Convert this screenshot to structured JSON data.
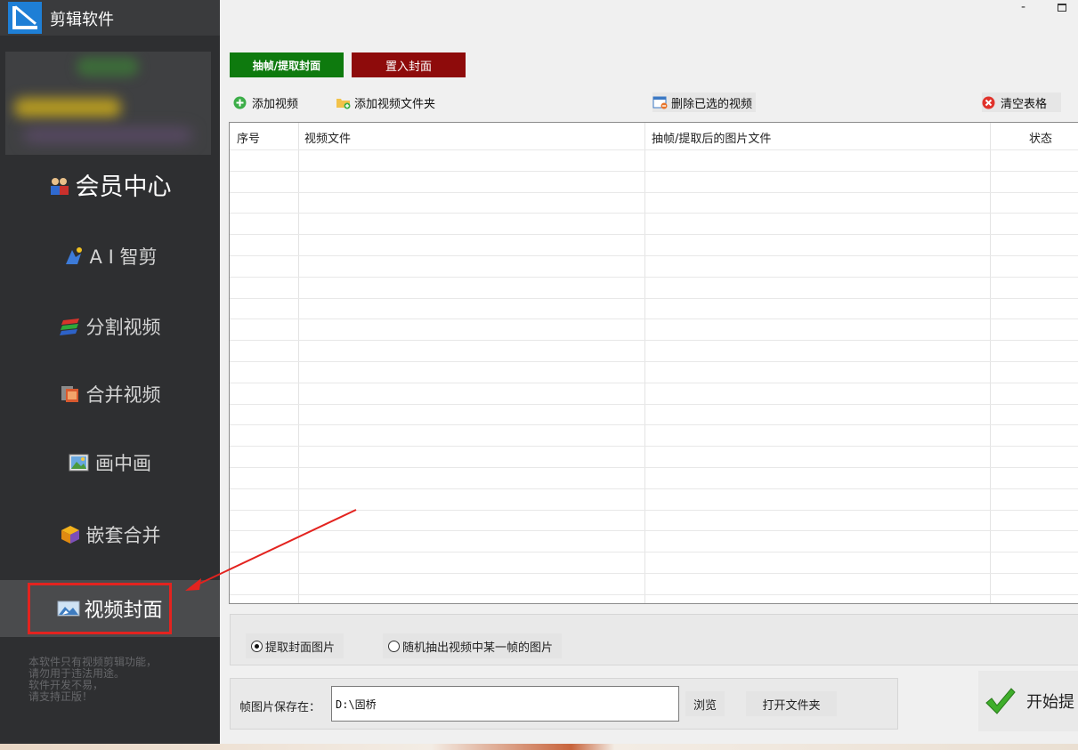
{
  "app": {
    "title": "剪辑软件"
  },
  "sidebar": {
    "items": [
      {
        "label": "会员中心",
        "icon": "member-icon"
      },
      {
        "label": "A I 智剪",
        "icon": "ai-icon"
      },
      {
        "label": "分割视频",
        "icon": "split-icon"
      },
      {
        "label": "合并视频",
        "icon": "merge-icon"
      },
      {
        "label": "画中画",
        "icon": "picture-in-picture-icon"
      },
      {
        "label": "嵌套合并",
        "icon": "nest-icon"
      },
      {
        "label": "视频封面",
        "icon": "cover-icon",
        "selected": true
      }
    ],
    "notice": [
      "本软件只有视频剪辑功能，",
      "请勿用于违法用途。",
      "软件开发不易，",
      "请支持正版！"
    ]
  },
  "window": {
    "minimize": "-"
  },
  "tabs": {
    "extract": "抽帧/提取封面",
    "embed": "置入封面"
  },
  "toolbar": {
    "add_video": "添加视频",
    "add_folder": "添加视频文件夹",
    "delete_selected": "删除已选的视频",
    "clear_table": "清空表格"
  },
  "table": {
    "columns": [
      "序号",
      "视频文件",
      "抽帧/提取后的图片文件",
      "状态"
    ],
    "rows": []
  },
  "options": {
    "extract_cover": "提取封面图片",
    "random_frame": "随机抽出视频中某一帧的图片",
    "selected": "extract_cover"
  },
  "save": {
    "label": "帧图片保存在：",
    "path": "D:\\固桥",
    "browse": "浏览",
    "open_folder": "打开文件夹"
  },
  "start": {
    "label": "开始提"
  },
  "colors": {
    "sidebar_bg": "#2e2f31",
    "tab_extract": "#0e7a0e",
    "tab_embed": "#8e0b0b",
    "highlight": "#e3231f"
  }
}
